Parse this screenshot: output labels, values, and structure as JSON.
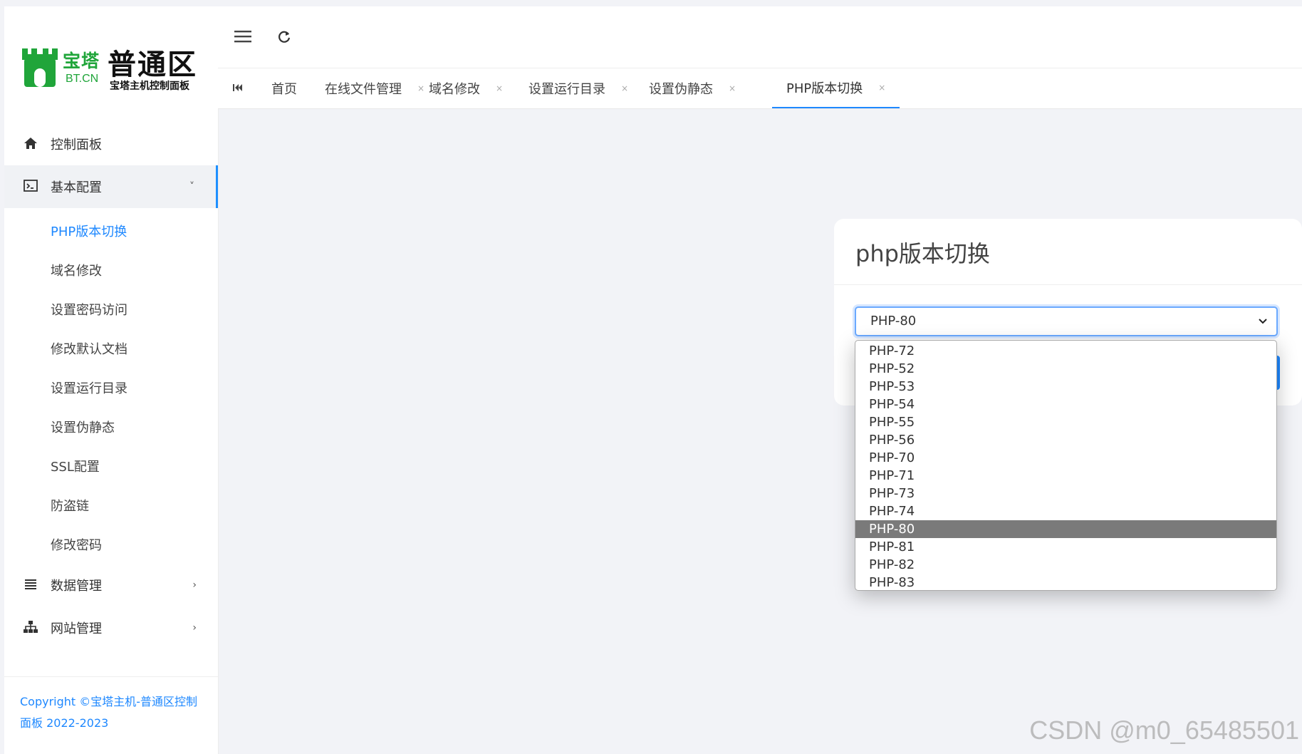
{
  "brand": {
    "logo_cn": "宝塔",
    "logo_en": "BT.CN",
    "title": "普通区",
    "subtitle": "宝塔主机控制面板"
  },
  "sidebar": {
    "items": [
      {
        "label": "控制面板",
        "icon": "home-icon"
      },
      {
        "label": "基本配置",
        "icon": "terminal-icon",
        "arrow": "˅"
      },
      {
        "label": "数据管理",
        "icon": "list-icon",
        "arrow": "›"
      },
      {
        "label": "网站管理",
        "icon": "sitemap-icon",
        "arrow": "›"
      }
    ],
    "submenu": [
      {
        "label": "PHP版本切换"
      },
      {
        "label": "域名修改"
      },
      {
        "label": "设置密码访问"
      },
      {
        "label": "修改默认文档"
      },
      {
        "label": "设置运行目录"
      },
      {
        "label": "设置伪静态"
      },
      {
        "label": "SSL配置"
      },
      {
        "label": "防盗链"
      },
      {
        "label": "修改密码"
      }
    ],
    "copyright": "Copyright ©宝塔主机-普通区控制面板 2022-2023"
  },
  "tabs": [
    {
      "label": "首页"
    },
    {
      "label": "在线文件管理",
      "close": "×"
    },
    {
      "label": "域名修改",
      "close": "×"
    },
    {
      "label": "设置运行目录",
      "close": "×"
    },
    {
      "label": "设置伪静态",
      "close": "×"
    },
    {
      "label": "PHP版本切换",
      "close": "×"
    }
  ],
  "card": {
    "title": "php版本切换",
    "select_value": "PHP-80"
  },
  "dropdown": {
    "options": [
      "PHP-72",
      "PHP-52",
      "PHP-53",
      "PHP-54",
      "PHP-55",
      "PHP-56",
      "PHP-70",
      "PHP-71",
      "PHP-73",
      "PHP-74",
      "PHP-80",
      "PHP-81",
      "PHP-82",
      "PHP-83"
    ],
    "selected": "PHP-80"
  },
  "watermark": "CSDN @m0_65485501",
  "colors": {
    "accent": "#1e88ff",
    "brand": "#20a53a"
  }
}
